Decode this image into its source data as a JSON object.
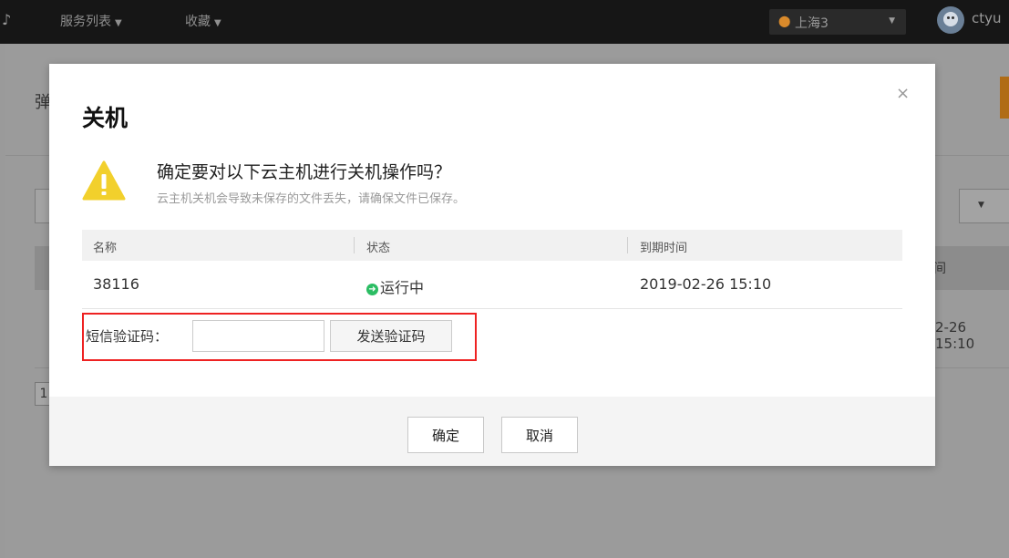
{
  "topbar": {
    "logo_glyph": "♪",
    "menu_services": "服务列表",
    "menu_favorites": "收藏",
    "dropdown_caret": "▼",
    "region": "上海3",
    "region_caret": "▼",
    "username": "ctyu"
  },
  "background": {
    "page_title_fragment": "弹",
    "table_header_fragment": "间",
    "expire_fragment": "2-26 15:10",
    "pagination_fragment": "1",
    "select_caret": "▼"
  },
  "modal": {
    "title": "关机",
    "close": "×",
    "message": "确定要对以下云主机进行关机操作吗？",
    "sub_message": "云主机关机会导致未保存的文件丢失，请确保文件已保存。",
    "table": {
      "headers": [
        "名称",
        "状态",
        "到期时间"
      ],
      "rows": [
        {
          "name": "38116",
          "status": "运行中",
          "expire": "2019-02-26 15:10"
        }
      ]
    },
    "sms_label": "短信验证码：",
    "sms_input_value": "",
    "send_code_button": "发送验证码",
    "confirm_button": "确定",
    "cancel_button": "取消"
  },
  "colors": {
    "warning_icon": "#f2d02c",
    "status_running": "#2bbd63",
    "highlight_border": "#ee2222"
  }
}
